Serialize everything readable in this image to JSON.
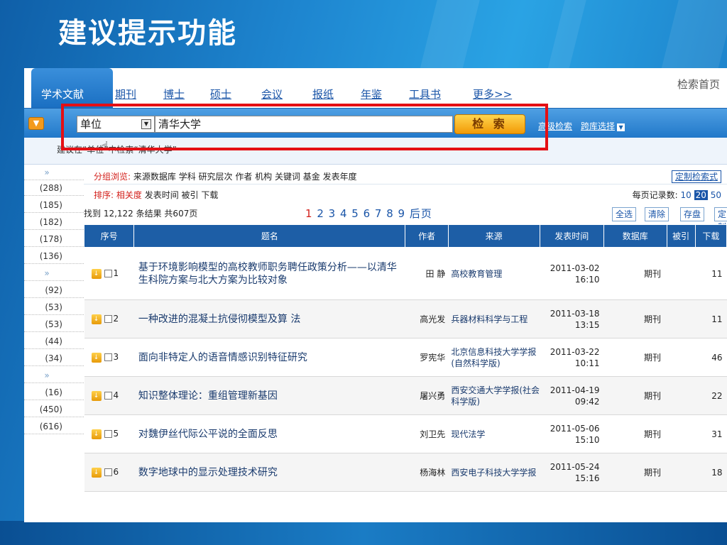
{
  "slide": {
    "title": "建议提示功能"
  },
  "tabs": [
    {
      "label": "学术文献"
    },
    {
      "label": "期刊"
    },
    {
      "label": "博士"
    },
    {
      "label": "硕士"
    },
    {
      "label": "会议"
    },
    {
      "label": "报纸"
    },
    {
      "label": "年鉴"
    },
    {
      "label": "工具书"
    },
    {
      "label": "更多>>"
    }
  ],
  "home_link": "检索首页",
  "search": {
    "field_type": "单位",
    "query": "清华大学",
    "button": "检 索",
    "advanced": "高级检索",
    "cross_db": "跨库选择"
  },
  "suggestion": "建议在“单位”中检索“清华大学”",
  "sidebar": {
    "rows": [
      "(288)",
      "(185)",
      "(182)",
      "(178)",
      "(136)",
      "(92)",
      "(53)",
      "(53)",
      "(44)",
      "(34)",
      "(16)",
      "(450)",
      "(616)"
    ],
    "chevron": "»"
  },
  "group_browse": {
    "label": "分组浏览:",
    "items": "来源数据库 学科 研究层次 作者 机构 关键词 基金 发表年度",
    "custom": "定制检索式"
  },
  "sort": {
    "label": "排序:",
    "active": "相关度",
    "items": "发表时间 被引 下载",
    "per_page_label": "每页记录数:",
    "per_page": [
      "10",
      "20",
      "50"
    ]
  },
  "result_info": {
    "found": "找到 12,122 条结果 共607页",
    "current_page": "1",
    "pages": "2 3 4 5 6 7 8 9 后页",
    "actions": [
      "全选",
      "清除",
      "存盘",
      "定制"
    ]
  },
  "table": {
    "headers": [
      "序号",
      "题名",
      "作者",
      "来源",
      "发表时间",
      "数据库",
      "被引",
      "下载"
    ],
    "rows": [
      {
        "no": "1",
        "title": "基于环境影响模型的高校教师职务聘任政策分析——以清华生科院方案与北大方案为比较对象",
        "author": "田 静",
        "source": "高校教育管理",
        "date": "2011-03-02",
        "time": "16:10",
        "db": "期刊",
        "cite": "",
        "dl": "11"
      },
      {
        "no": "2",
        "title": "一种改进的混凝土抗侵彻模型及算 法",
        "author": "高光发",
        "source": "兵器材料科学与工程",
        "date": "2011-03-18",
        "time": "13:15",
        "db": "期刊",
        "cite": "",
        "dl": "11"
      },
      {
        "no": "3",
        "title": "面向非特定人的语音情感识别特征研究",
        "author": "罗宪华",
        "source": "北京信息科技大学学报(自然科学版)",
        "date": "2011-03-22",
        "time": "10:11",
        "db": "期刊",
        "cite": "",
        "dl": "46"
      },
      {
        "no": "4",
        "title": "知识整体理论：重组管理新基因",
        "author": "屠兴勇",
        "source": "西安交通大学学报(社会科学版)",
        "date": "2011-04-19",
        "time": "09:42",
        "db": "期刊",
        "cite": "",
        "dl": "22"
      },
      {
        "no": "5",
        "title": "对魏伊丝代际公平说的全面反思",
        "author": "刘卫先",
        "source": "现代法学",
        "date": "2011-05-06",
        "time": "15:10",
        "db": "期刊",
        "cite": "",
        "dl": "31"
      },
      {
        "no": "6",
        "title": "数字地球中的显示处理技术研究",
        "author": "杨海林",
        "source": "西安电子科技大学学报",
        "date": "2011-05-24",
        "time": "15:16",
        "db": "期刊",
        "cite": "",
        "dl": "18"
      }
    ]
  },
  "colors": {
    "accent": "#1d5ea6",
    "highlight_box": "#e40f14",
    "search_button": "#f29a06"
  }
}
